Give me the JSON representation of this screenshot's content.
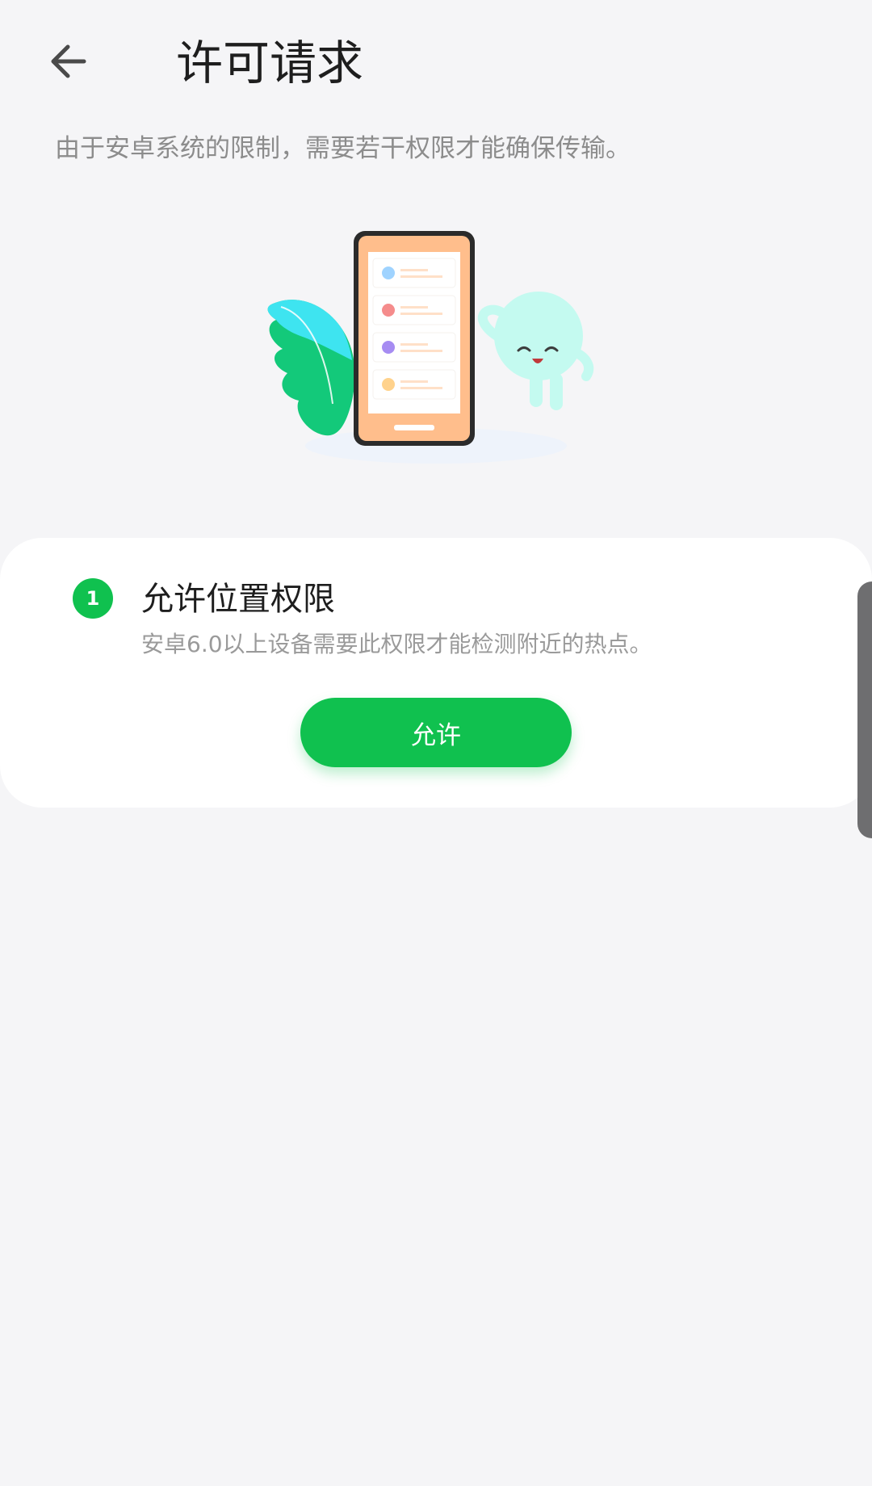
{
  "header": {
    "back_icon": "arrow-left-icon",
    "title": "许可请求"
  },
  "intro": {
    "text": "由于安卓系统的限制，需要若干权限才能确保传输。"
  },
  "illustration": {
    "subject": "phone-with-list-and-mascot",
    "colors": {
      "phone_body": "#ffbe8c",
      "phone_frame": "#2b2b2b",
      "leaf_top": "#3ee4f0",
      "leaf_bottom": "#13c97a",
      "mascot": "#c4faf0",
      "dot_blue": "#9fd3ff",
      "dot_red": "#f58c8c",
      "dot_purple": "#a68cf2",
      "dot_yellow": "#ffd28c"
    }
  },
  "permissions": [
    {
      "step": "1",
      "title": "允许位置权限",
      "description": "安卓6.0以上设备需要此权限才能检测附近的热点。",
      "button_label": "允许"
    }
  ],
  "colors": {
    "accent": "#10c14f",
    "background": "#f5f5f7",
    "card": "#ffffff"
  }
}
